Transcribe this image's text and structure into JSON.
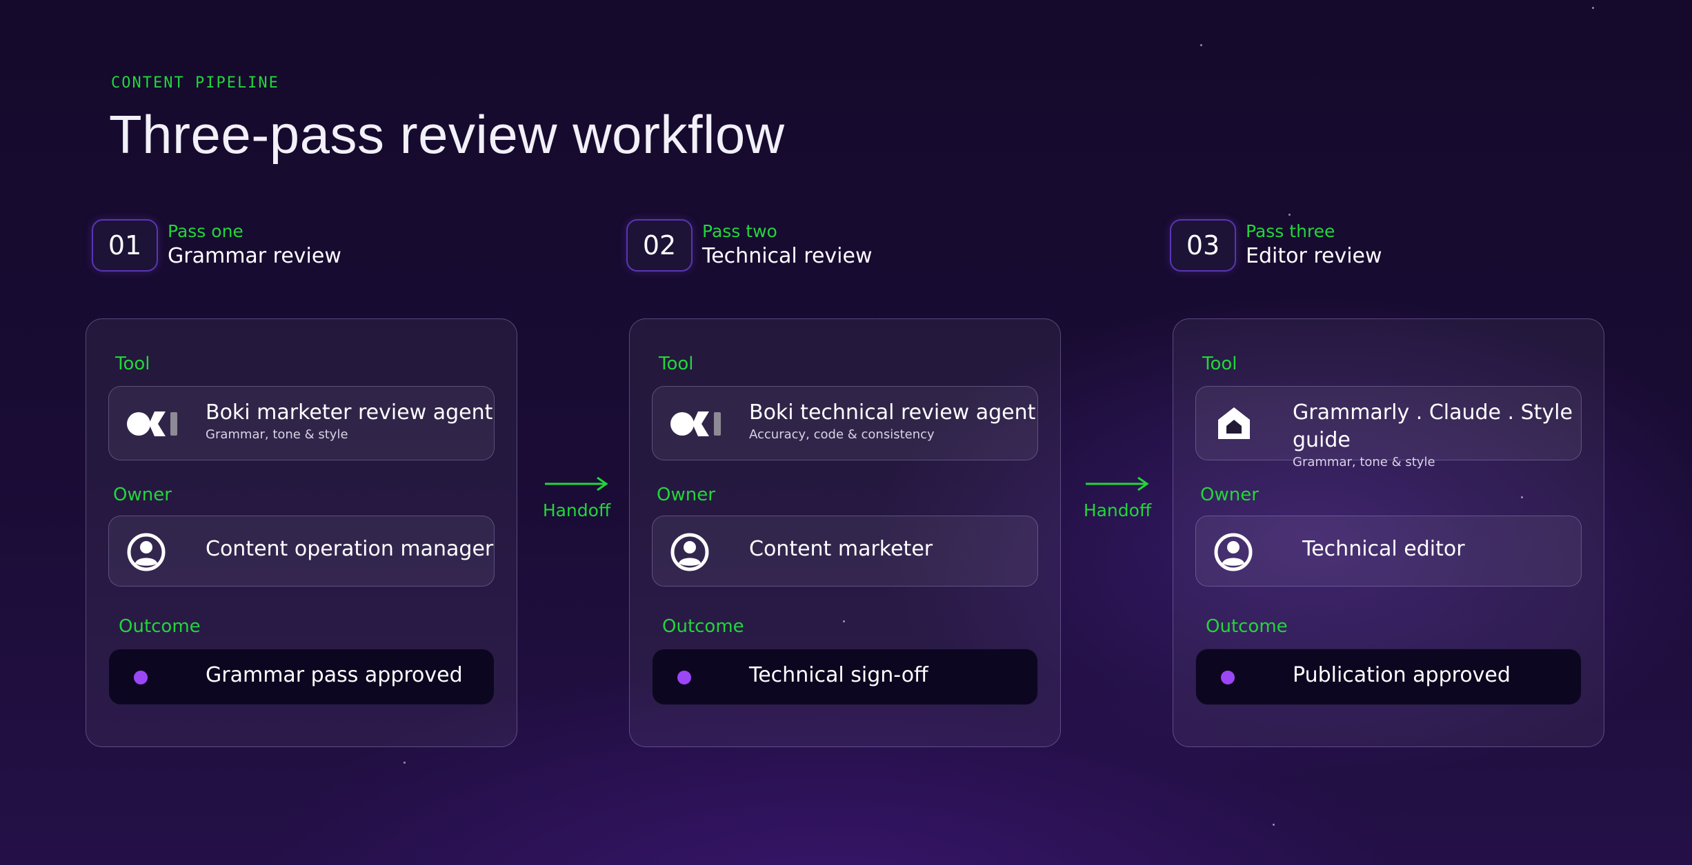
{
  "header": {
    "eyebrow": "CONTENT PIPELINE",
    "title": "Three-pass review workflow"
  },
  "labels": {
    "tool": "Tool",
    "owner": "Owner",
    "outcome": "Outcome",
    "handoff": "Handoff"
  },
  "colors": {
    "accent_green": "#22d63a",
    "outcome_dot": "#9b47f5",
    "badge_border": "#5a35b5"
  },
  "stages": [
    {
      "number": "01",
      "pass": "Pass one",
      "name": "Grammar review",
      "tool": {
        "name": "Boki marketer review agent",
        "sub": "Grammar, tone & style",
        "icon": "boki-logo-icon"
      },
      "owner": {
        "name": "Content operation manager",
        "icon": "user-avatar-icon"
      },
      "outcome": "Grammar pass approved"
    },
    {
      "number": "02",
      "pass": "Pass two",
      "name": "Technical review",
      "tool": {
        "name": "Boki technical review agent",
        "sub": "Accuracy, code & consistency",
        "icon": "boki-logo-icon"
      },
      "owner": {
        "name": "Content marketer",
        "icon": "user-avatar-icon"
      },
      "outcome": "Technical sign-off"
    },
    {
      "number": "03",
      "pass": "Pass three",
      "name": "Editor review",
      "tool": {
        "name": "Grammarly . Claude . Style guide",
        "sub": "Grammar, tone & style",
        "icon": "house-logo-icon"
      },
      "owner": {
        "name": "Technical editor",
        "icon": "user-avatar-icon"
      },
      "outcome": "Publication approved"
    }
  ]
}
